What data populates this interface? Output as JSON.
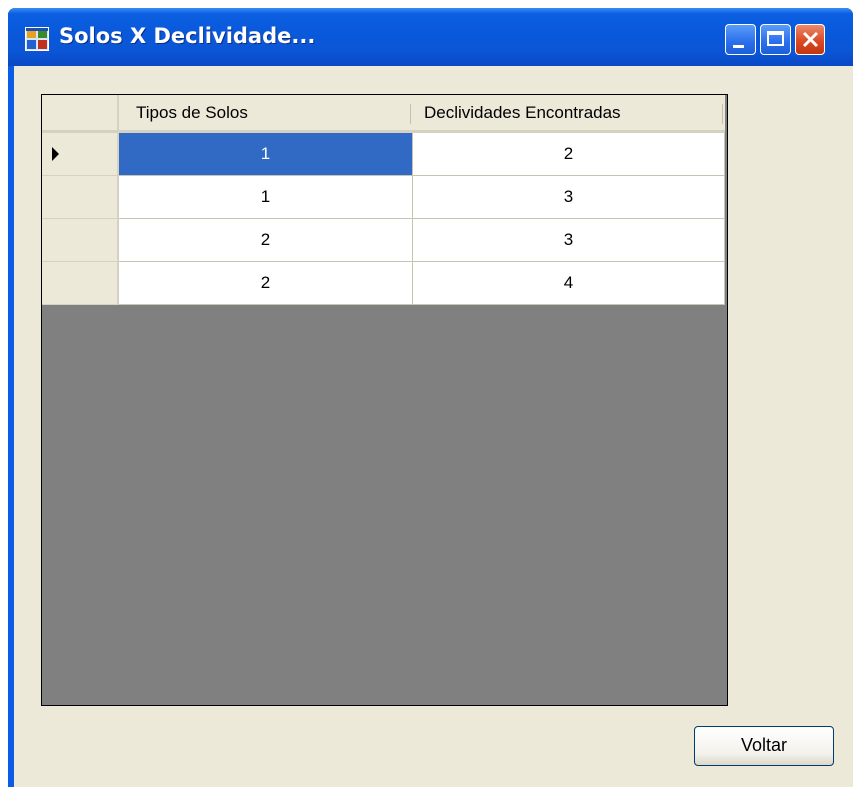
{
  "window": {
    "title": "Solos X Declividade...",
    "icon": "windows-app-icon",
    "controls": {
      "minimize_icon": "minimize-icon",
      "maximize_icon": "maximize-icon",
      "close_icon": "close-icon"
    }
  },
  "grid": {
    "columns": [
      "Tipos de Solos",
      "Declividades Encontradas"
    ],
    "rows": [
      {
        "tipos": "1",
        "declividades": "2",
        "current": true
      },
      {
        "tipos": "1",
        "declividades": "3"
      },
      {
        "tipos": "2",
        "declividades": "3"
      },
      {
        "tipos": "2",
        "declividades": "4"
      }
    ],
    "selected_cell": {
      "row": 0,
      "column": 0
    }
  },
  "buttons": {
    "voltar_label": "Voltar"
  },
  "colors": {
    "titlebar": "#0a58db",
    "selection": "#316ac5",
    "grid_background": "#808080",
    "client_background": "#ece9d8"
  }
}
